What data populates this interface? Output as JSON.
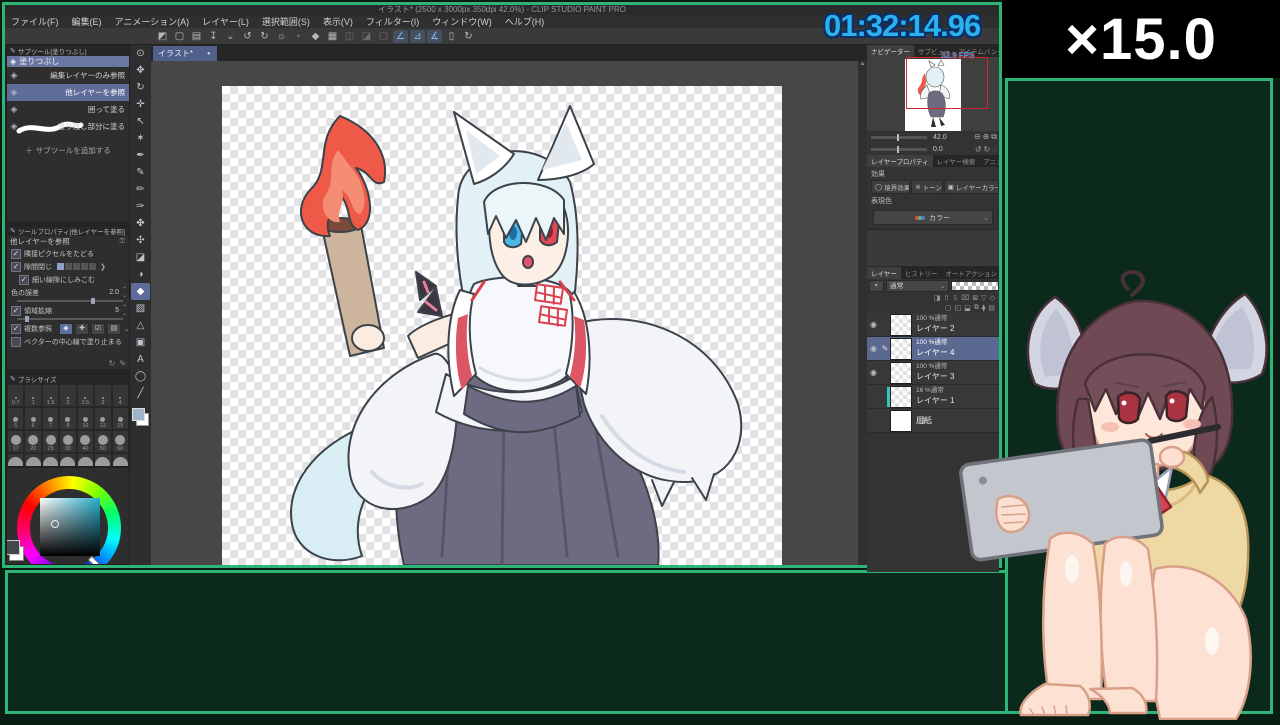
{
  "overlay": {
    "timer": "01:32:14.96",
    "speed": "×15.0",
    "fps": "32.9 FPS"
  },
  "window": {
    "title": "イラスト* (2500 x 3000px 350dpi 42.0%) - CLIP STUDIO PAINT PRO",
    "menu": [
      "ファイル(F)",
      "編集(E)",
      "アニメーション(A)",
      "レイヤー(L)",
      "選択範囲(S)",
      "表示(V)",
      "フィルター(I)",
      "ウィンドウ(W)",
      "ヘルプ(H)"
    ],
    "canvas_tab": "イラスト*",
    "tab_dot": "●"
  },
  "cmdbar": {
    "icons": [
      {
        "name": "clip-studio-icon",
        "glyph": "◩"
      },
      {
        "name": "new-canvas-icon",
        "glyph": "▢"
      },
      {
        "name": "open-file-icon",
        "glyph": "▤"
      },
      {
        "name": "save-icon",
        "glyph": "↧"
      },
      {
        "name": "save-chevron-icon",
        "glyph": "⌄"
      },
      {
        "name": "undo-icon",
        "glyph": "↺"
      },
      {
        "name": "redo-icon",
        "glyph": "↻"
      },
      {
        "name": "clear-icon",
        "glyph": "☼"
      },
      {
        "name": "fill-icon",
        "glyph": "▪",
        "dim": true
      },
      {
        "name": "eraser-icon",
        "glyph": "◆"
      },
      {
        "name": "crop-marks-icon",
        "glyph": "▦"
      },
      {
        "name": "deselect-icon",
        "glyph": "◫",
        "dim": true
      },
      {
        "name": "invert-selection-icon",
        "glyph": "◪",
        "dim": true
      },
      {
        "name": "selection-border-icon",
        "glyph": "▢",
        "dim": true
      },
      {
        "name": "snap-ruler-icon",
        "glyph": "∠",
        "blue": true
      },
      {
        "name": "snap-special-ruler-icon",
        "glyph": "⊿",
        "blue": true
      },
      {
        "name": "snap-grid-icon",
        "glyph": "∡",
        "blue": true
      },
      {
        "name": "tablet-icon",
        "glyph": "▯"
      },
      {
        "name": "view-rotate-icon",
        "glyph": "↻"
      }
    ]
  },
  "subtool": {
    "title": "サブツール[塗りつぶし]",
    "group_label": "塗りつぶし",
    "rows": [
      {
        "label": "編集レイヤーのみ参照",
        "selected": false
      },
      {
        "label": "他レイヤーを参照",
        "selected": true
      },
      {
        "label": "囲って塗る",
        "selected": false
      },
      {
        "label": "塗り残し部分に塗る",
        "selected": false,
        "squiggle": true
      }
    ],
    "add_label": "サブツールを追加する",
    "add_plus": "＋"
  },
  "tool_property": {
    "title": "ツールプロパティ[他レイヤーを参照]",
    "header_label": "他レイヤーを参照",
    "lock_icon": "⚿",
    "rows": [
      {
        "type": "check",
        "label": "隣接ピクセルをたどる",
        "checked": true
      },
      {
        "type": "gap",
        "label": "隙間閉じ",
        "checked": true,
        "arrow": "❯"
      },
      {
        "type": "check",
        "label": "細い線隙にしみこむ",
        "checked": true,
        "indent": true
      },
      {
        "type": "value",
        "label": "色の誤差",
        "value": "2.0"
      },
      {
        "type": "checkvalue",
        "label": "領域拡縮",
        "value": "5",
        "checked": true
      },
      {
        "type": "icons",
        "label": "複数参照",
        "checked": true,
        "icons": [
          "◈",
          "✚",
          "☑",
          "▤"
        ],
        "chev": "⌄"
      },
      {
        "type": "check",
        "label": "ベクターの中心線で塗り止まる",
        "checked": false
      }
    ],
    "footer_icons": [
      "↻",
      "✎"
    ]
  },
  "brush": {
    "title": "ブラシサイズ",
    "sizes": [
      "0.7",
      "1",
      "1.5",
      "2",
      "2.5",
      "3",
      "4",
      "5",
      "6",
      "7",
      "8",
      "10",
      "12",
      "15",
      "17",
      "20",
      "25",
      "30",
      "40",
      "50",
      "60"
    ],
    "unlabeled_cells": 7
  },
  "tools": {
    "items": [
      {
        "name": "zoom-tool",
        "glyph": "⊙"
      },
      {
        "name": "hand-tool",
        "glyph": "✥"
      },
      {
        "name": "rotate-canvas-tool",
        "glyph": "↻"
      },
      {
        "name": "move-tool",
        "glyph": "✛"
      },
      {
        "name": "object-tool",
        "glyph": "↖"
      },
      {
        "name": "auto-select-tool",
        "glyph": "✶"
      },
      {
        "name": "eyedropper-tool",
        "glyph": "✒"
      },
      {
        "name": "pen-tool",
        "glyph": "✎"
      },
      {
        "name": "pencil-tool",
        "glyph": "✏"
      },
      {
        "name": "brush-tool",
        "glyph": "✑"
      },
      {
        "name": "airbrush-tool",
        "glyph": "✤"
      },
      {
        "name": "decoration-tool",
        "glyph": "✣"
      },
      {
        "name": "eraser-tool",
        "glyph": "◪"
      },
      {
        "name": "blend-tool",
        "glyph": "◑"
      },
      {
        "name": "fill-tool",
        "glyph": "◆",
        "selected": true
      },
      {
        "name": "gradient-tool",
        "glyph": "▨"
      },
      {
        "name": "figure-tool",
        "glyph": "△"
      },
      {
        "name": "frame-border-tool",
        "glyph": "▣"
      },
      {
        "name": "text-tool",
        "glyph": "A"
      },
      {
        "name": "balloon-tool",
        "glyph": "◯"
      },
      {
        "name": "correct-line-tool",
        "glyph": "╱"
      }
    ]
  },
  "navigator": {
    "tabs": [
      {
        "label": "ナビゲーター",
        "active": true
      },
      {
        "label": "サブビュー",
        "active": false
      },
      {
        "label": "アイテムバンク",
        "active": false
      }
    ],
    "zoom_value": "42.0",
    "zoom_buttons": [
      "⊖",
      "⊕",
      "⧉"
    ],
    "rotate_value": "0.0",
    "rotate_buttons": [
      "↺",
      "↻",
      "◌"
    ]
  },
  "layer_property": {
    "tabs": [
      {
        "label": "レイヤープロパティ",
        "active": true
      },
      {
        "label": "レイヤー検索",
        "active": false
      },
      {
        "label": "アニメーション",
        "active": false
      }
    ],
    "effect_label": "効果",
    "effects": [
      {
        "name": "border-effect",
        "glyph": "◯",
        "label": "境界効果"
      },
      {
        "name": "tone-effect",
        "glyph": "※",
        "label": "トーン"
      },
      {
        "name": "layer-color-effect",
        "glyph": "▣",
        "label": "レイヤーカラー"
      }
    ],
    "expression_label": "表現色",
    "expression_value": "カラー",
    "chevron": "⌄"
  },
  "layers": {
    "tabs": [
      {
        "label": "レイヤー",
        "active": true
      },
      {
        "label": "ヒストリー",
        "active": false
      },
      {
        "label": "オートアクション",
        "active": false
      }
    ],
    "blend_mode": "通常",
    "blend_chevron": "⌄",
    "combo_glyph": "▾",
    "icons_row1": [
      "◨",
      "⇧",
      "⇩",
      "⌧",
      "⊠",
      "▽",
      "◇"
    ],
    "icons_row2": [
      "▢",
      "◰",
      "⬓",
      "⧉",
      "⧫",
      "▤"
    ],
    "rows": [
      {
        "opacity": "100 %通常",
        "name": "レイヤー 2",
        "eye": true,
        "edit": false,
        "selected": false,
        "thumb": "checker"
      },
      {
        "opacity": "100 %通常",
        "name": "レイヤー 4",
        "eye": true,
        "edit": true,
        "selected": true,
        "thumb": "checker"
      },
      {
        "opacity": "100 %通常",
        "name": "レイヤー 3",
        "eye": true,
        "edit": false,
        "selected": false,
        "thumb": "checker"
      },
      {
        "opacity": "16 %通常",
        "name": "レイヤー 1",
        "eye": false,
        "edit": false,
        "selected": false,
        "thumb": "checker",
        "accent": true
      },
      {
        "opacity": "",
        "name": "用紙",
        "eye": false,
        "edit": false,
        "selected": false,
        "thumb": "white",
        "paper": true
      }
    ],
    "eye_glyph": "◉",
    "edit_glyph": "✎",
    "paper_glyph": "❏"
  },
  "colors": {
    "frame_green": "#2fb478",
    "panel_green": "#0c2a1c",
    "timer_blue": "#2ab1ee",
    "selection_blue": "#5f6c99",
    "red_view_rect": "#cc2a2a"
  }
}
